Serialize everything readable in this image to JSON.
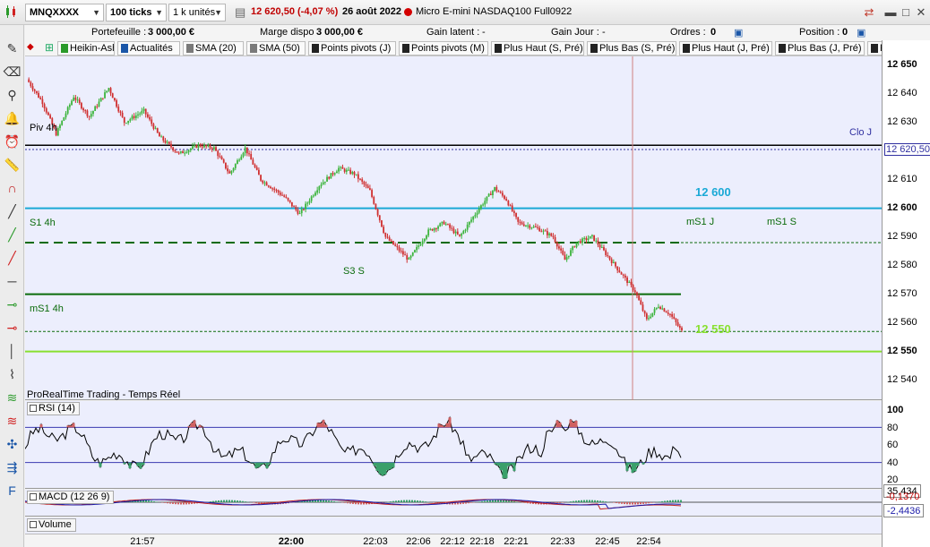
{
  "toolbar": {
    "instrument": "MNQXXXX",
    "period": "100 ticks",
    "units": "1 k unités",
    "price": "12 620,50 (-4,07 %)",
    "date": "26 août 2022",
    "instrument_name": "Micro E-mini NASDAQ100 Full0922",
    "live_color": "#d40000"
  },
  "info": {
    "portefeuille_label": "Portefeuille :",
    "portefeuille_value": "3 000,00 €",
    "marge_label": "Marge dispo",
    "marge_value": "3 000,00 €",
    "gain_latent_label": "Gain latent :",
    "gain_latent_value": "-",
    "gain_jour_label": "Gain Jour :",
    "gain_jour_value": "-",
    "ordres_label": "Ordres :",
    "ordres_value": "0",
    "position_label": "Position :",
    "position_value": "0"
  },
  "tabs": [
    {
      "label": "Heikin-Ashi",
      "color": "#2a9a2a"
    },
    {
      "label": "Actualités",
      "color": "#1a56a8"
    },
    {
      "label": "SMA (20)",
      "color": "#7a7a7a"
    },
    {
      "label": "SMA (50)",
      "color": "#7a7a7a"
    },
    {
      "label": "Points pivots (J)",
      "color": "#222222"
    },
    {
      "label": "Points pivots (M)",
      "color": "#222222"
    },
    {
      "label": "Plus Haut (S, Pré)",
      "color": "#222222"
    },
    {
      "label": "Plus Bas (S, Pré)",
      "color": "#222222"
    },
    {
      "label": "Plus Haut (J, Pré)",
      "color": "#222222"
    },
    {
      "label": "Plus Bas (J, Pré)",
      "color": "#222222"
    },
    {
      "label": "Poi",
      "color": "#222222"
    }
  ],
  "left_tools": [
    "pencil-icon",
    "eraser-icon",
    "zoom-icon",
    "alarm-icon",
    "alarm-gear-icon",
    "ruler-icon",
    "magnet-icon",
    "line-icon",
    "line-green-icon",
    "line-red-icon",
    "hline-icon",
    "hline-green-icon",
    "hline-red-icon",
    "vline-icon",
    "polyline-icon",
    "fibonacci-icon",
    "fibonacci-red-icon",
    "gann-icon",
    "channel-icon",
    "text-icon"
  ],
  "price_panel": {
    "labels": {
      "piv4h": "Piv 4h",
      "clo_j": "Clo J",
      "level_12600": "12 600",
      "s1_4h": "S1 4h",
      "ms1_j": "mS1 J",
      "ms1_s": "mS1 S",
      "s3_s": "S3 S",
      "ms1_4h": "mS1 4h",
      "level_12550": "12 550",
      "watermark": "ProRealTime Trading - Temps Réel"
    },
    "colors": {
      "piv": "#000000",
      "clo": "#3030a0",
      "cyan": "#1aa9d6",
      "s1": "#0b6b0b",
      "s3": "#0b6b0b",
      "lime": "#88e030",
      "up": "#3cb43c",
      "down": "#d03030",
      "cursor": "#d08080"
    },
    "y_ticks": [
      "12 650",
      "12 640",
      "12 630",
      "12 620,50",
      "12 610",
      "12 600",
      "12 590",
      "12 580",
      "12 570",
      "12 560",
      "12 550",
      "12 540"
    ]
  },
  "rsi_panel": {
    "title": "RSI (14)",
    "ticks": [
      "100",
      "80",
      "60",
      "40",
      "20"
    ],
    "value": "35,434"
  },
  "macd_panel": {
    "title": "MACD (12 26 9)",
    "value1": "-0,1370",
    "value2": "-2,4436"
  },
  "volume_panel": {
    "title": "Volume"
  },
  "x_axis": {
    "ticks": [
      "21:57",
      "22:00",
      "22:03",
      "22:06",
      "22:12",
      "22:18",
      "22:21",
      "22:33",
      "22:45",
      "22:54"
    ]
  },
  "chart_data": {
    "type": "candlestick",
    "title": "",
    "ylim": [
      12533,
      12653
    ],
    "key_levels": [
      {
        "name": "Piv 4h",
        "value": 12622
      },
      {
        "name": "Clo J",
        "value": 12620.5
      },
      {
        "name": "12 600",
        "value": 12600
      },
      {
        "name": "S1 4h / mS1 J / mS1 S",
        "value": 12588
      },
      {
        "name": "S3 S",
        "value": 12570
      },
      {
        "name": "mS1 4h",
        "value": 12557
      },
      {
        "name": "12 550",
        "value": 12550
      }
    ],
    "close_path": [
      {
        "t": 0,
        "v": 12645
      },
      {
        "t": 8,
        "v": 12637
      },
      {
        "t": 15,
        "v": 12626
      },
      {
        "t": 24,
        "v": 12639
      },
      {
        "t": 32,
        "v": 12632
      },
      {
        "t": 42,
        "v": 12642
      },
      {
        "t": 50,
        "v": 12630
      },
      {
        "t": 60,
        "v": 12634
      },
      {
        "t": 68,
        "v": 12625
      },
      {
        "t": 78,
        "v": 12619
      },
      {
        "t": 88,
        "v": 12622
      },
      {
        "t": 96,
        "v": 12621
      },
      {
        "t": 104,
        "v": 12612
      },
      {
        "t": 112,
        "v": 12621
      },
      {
        "t": 120,
        "v": 12610
      },
      {
        "t": 132,
        "v": 12604
      },
      {
        "t": 140,
        "v": 12598
      },
      {
        "t": 150,
        "v": 12608
      },
      {
        "t": 160,
        "v": 12614
      },
      {
        "t": 168,
        "v": 12612
      },
      {
        "t": 176,
        "v": 12606
      },
      {
        "t": 184,
        "v": 12590
      },
      {
        "t": 190,
        "v": 12586
      },
      {
        "t": 196,
        "v": 12582
      },
      {
        "t": 206,
        "v": 12592
      },
      {
        "t": 214,
        "v": 12595
      },
      {
        "t": 222,
        "v": 12590
      },
      {
        "t": 232,
        "v": 12600
      },
      {
        "t": 240,
        "v": 12607
      },
      {
        "t": 246,
        "v": 12603
      },
      {
        "t": 252,
        "v": 12595
      },
      {
        "t": 262,
        "v": 12593
      },
      {
        "t": 270,
        "v": 12590
      },
      {
        "t": 276,
        "v": 12582
      },
      {
        "t": 282,
        "v": 12588
      },
      {
        "t": 290,
        "v": 12590
      },
      {
        "t": 296,
        "v": 12585
      },
      {
        "t": 304,
        "v": 12578
      },
      {
        "t": 312,
        "v": 12571
      },
      {
        "t": 318,
        "v": 12561
      },
      {
        "t": 324,
        "v": 12566
      },
      {
        "t": 330,
        "v": 12563
      },
      {
        "t": 336,
        "v": 12557
      }
    ],
    "rsi": {
      "levels": [
        70,
        30
      ],
      "last": 35.434
    },
    "macd": {
      "macd_last": -0.137,
      "signal_last": -2.4436
    }
  }
}
